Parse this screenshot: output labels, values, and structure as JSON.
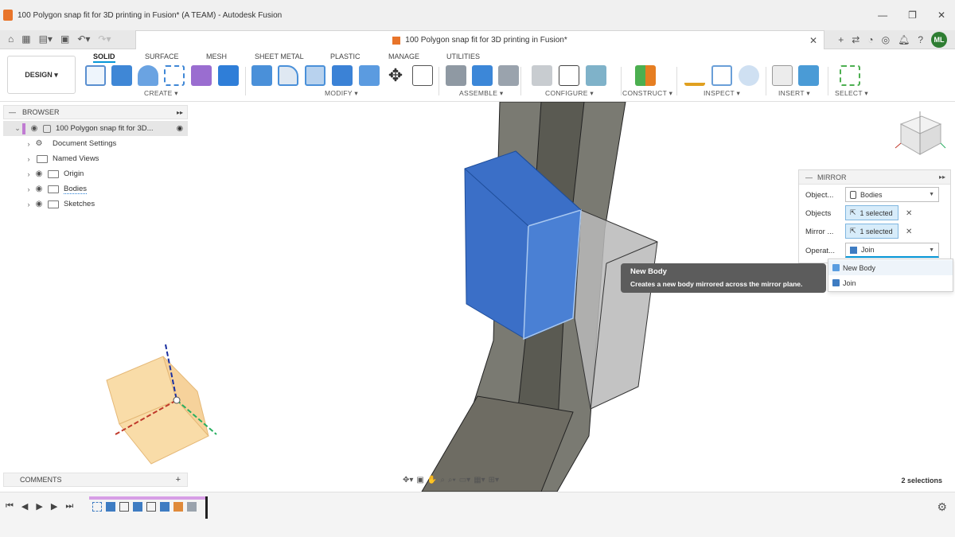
{
  "window": {
    "title": "100 Polygon snap fit for 3D printing in Fusion* (A TEAM) - Autodesk Fusion",
    "controls": [
      "—",
      "❐",
      "✕"
    ]
  },
  "tab": {
    "label": "100 Polygon snap fit for 3D printing in Fusion*",
    "close": "✕"
  },
  "user": {
    "initials": "ML"
  },
  "toolbar": {
    "workspace": "DESIGN ▾",
    "tabs": [
      "SOLID",
      "SURFACE",
      "MESH",
      "SHEET METAL",
      "PLASTIC",
      "MANAGE",
      "UTILITIES"
    ],
    "groups": [
      "CREATE ▾",
      "MODIFY ▾",
      "ASSEMBLE ▾",
      "CONFIGURE ▾",
      "CONSTRUCT ▾",
      "INSPECT ▾",
      "INSERT ▾",
      "SELECT ▾"
    ]
  },
  "browser": {
    "title": "BROWSER",
    "root": "100 Polygon snap fit for 3D...",
    "items": [
      "Document Settings",
      "Named Views",
      "Origin",
      "Bodies",
      "Sketches"
    ]
  },
  "mirror": {
    "title": "MIRROR",
    "object_type_label": "Object...",
    "object_type_value": "Bodies",
    "objects_label": "Objects",
    "objects_value": "1 selected",
    "mirror_plane_label": "Mirror ...",
    "mirror_plane_value": "1 selected",
    "operation_label": "Operat...",
    "operation_value": "Join"
  },
  "dropdown": {
    "options": [
      "New Body",
      "Join"
    ]
  },
  "tooltip": {
    "title": "New Body",
    "text": "Creates a new body mirrored across the mirror plane."
  },
  "comments": {
    "title": "COMMENTS"
  },
  "status": {
    "selections": "2 selections"
  },
  "colors": {
    "accent": "#0696d7",
    "selected_body": "#3b6fc7",
    "timeline": "#d79ee6"
  }
}
